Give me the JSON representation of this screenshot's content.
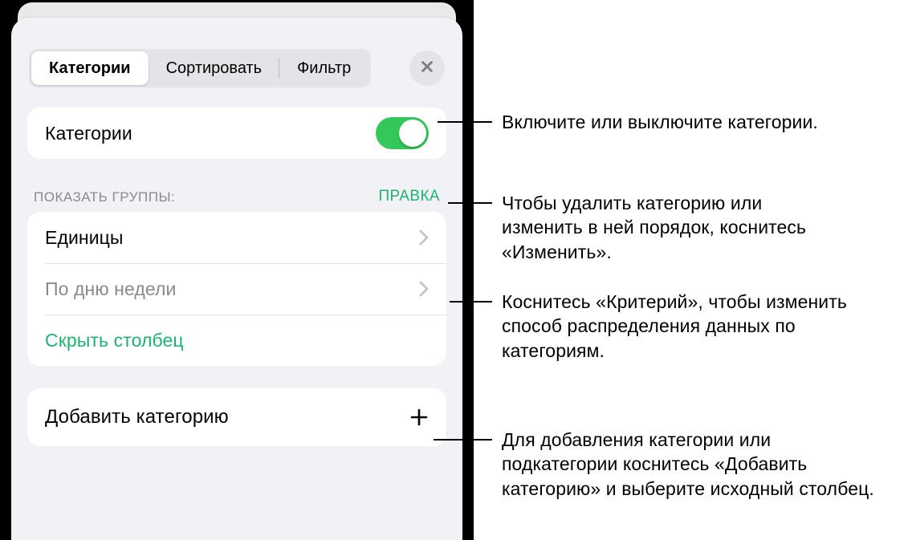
{
  "tabs": {
    "categories": "Категории",
    "sort": "Сортировать",
    "filter": "Фильтр"
  },
  "toggle_row": {
    "label": "Категории"
  },
  "section": {
    "title": "ПОКАЗАТЬ ГРУППЫ:",
    "edit": "ПРАВКА"
  },
  "groups": {
    "row0": "Единицы",
    "row1": "По дню недели",
    "hide": "Скрыть столбец"
  },
  "add_row": {
    "label": "Добавить категорию"
  },
  "callouts": {
    "toggle": "Включите или выключите категории.",
    "edit": "Чтобы удалить категорию или изменить в ней порядок, коснитесь «Изменить».",
    "criteria": "Коснитесь «Критерий», чтобы изменить способ распределения данных по категориям.",
    "add": "Для добавления категории или подкатегории коснитесь «Добавить категорию» и выберите исходный столбец."
  }
}
